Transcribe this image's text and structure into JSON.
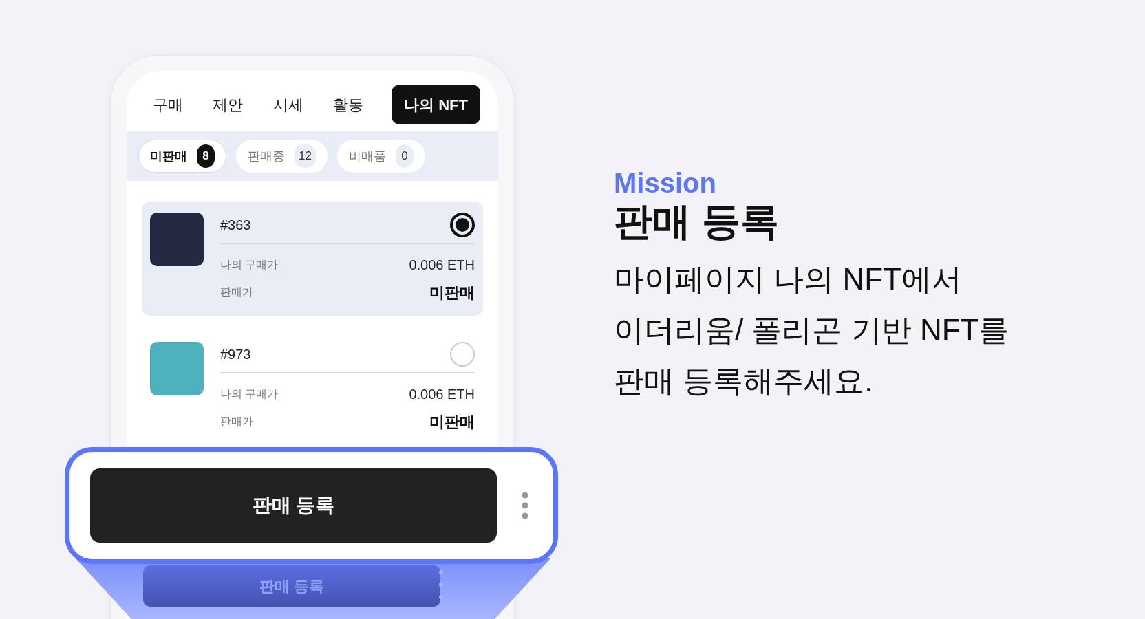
{
  "tabs": [
    {
      "label": "구매",
      "selected": false
    },
    {
      "label": "제안",
      "selected": false
    },
    {
      "label": "시세",
      "selected": false
    },
    {
      "label": "활동",
      "selected": false
    },
    {
      "label": "나의 NFT",
      "selected": true
    }
  ],
  "filters": [
    {
      "label": "미판매",
      "count": "8",
      "selected": true
    },
    {
      "label": "판매중",
      "count": "12",
      "selected": false
    },
    {
      "label": "비매품",
      "count": "0",
      "selected": false
    }
  ],
  "items": [
    {
      "id": "#363",
      "selected": true,
      "purchase_label": "나의 구매가",
      "purchase_price": "0.006 ETH",
      "sale_label": "판매가",
      "sale_price": "미판매"
    },
    {
      "id": "#973",
      "selected": false,
      "purchase_label": "나의 구매가",
      "purchase_price": "0.006 ETH",
      "sale_label": "판매가",
      "sale_price": "미판매"
    }
  ],
  "callout": {
    "button": "판매 등록"
  },
  "background_button": {
    "label": "판매 등록"
  },
  "mission": {
    "tag": "Mission",
    "title": "판매 등록",
    "body": [
      "마이페이지 나의 NFT에서",
      "이더리움/ 폴리곤 기반 NFT를",
      "판매 등록해주세요."
    ]
  }
}
